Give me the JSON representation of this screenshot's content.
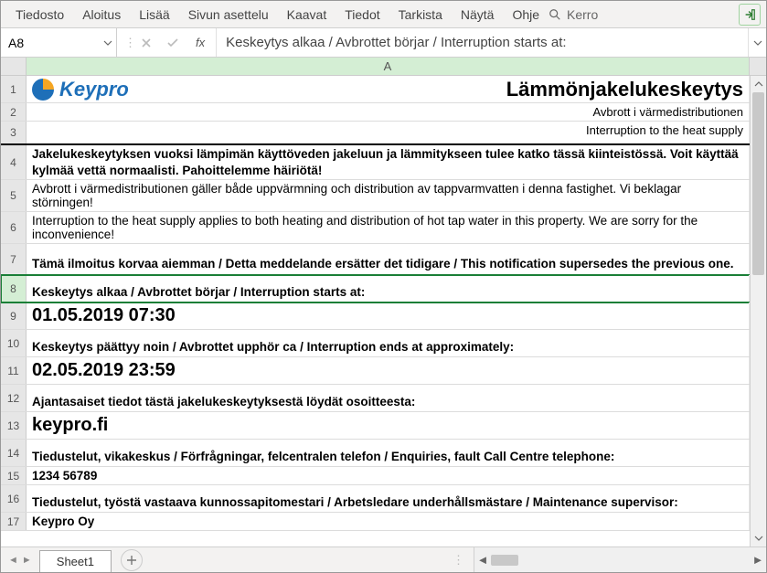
{
  "ribbon": {
    "tabs": [
      "Tiedosto",
      "Aloitus",
      "Lisää",
      "Sivun asettelu",
      "Kaavat",
      "Tiedot",
      "Tarkista",
      "Näytä",
      "Ohje"
    ],
    "tell": "Kerro"
  },
  "namebox": {
    "value": "A8"
  },
  "formula": {
    "fx": "fx",
    "value": "Keskeytys alkaa / Avbrottet börjar / Interruption starts at:"
  },
  "colHeaders": [
    "A"
  ],
  "sheet": {
    "brand": "Keypro",
    "title": "Lämmönjakelukeskeytys",
    "sub_sv": "Avbrott i värmedistributionen",
    "sub_en": "Interruption to the heat supply",
    "r4": "Jakelukeskeytyksen vuoksi lämpimän käyttöveden jakeluun ja lämmitykseen tulee katko tässä kiinteistössä. Voit käyttää kylmää vettä normaalisti. Pahoittelemme häiriötä!",
    "r5": "Avbrott i värmedistributionen gäller både uppvärmning och distribution av tappvarmvatten i denna fastighet. Vi beklagar störningen!",
    "r6": "Interruption to the heat supply applies to both heating and distribution of hot tap water in this property. We are sorry for the inconvenience!",
    "r7": "Tämä ilmoitus korvaa aiemman / Detta meddelande ersätter det tidigare / This notification supersedes the previous one.",
    "r8": "Keskeytys alkaa / Avbrottet börjar / Interruption starts at:",
    "r9": "01.05.2019 07:30",
    "r10": "Keskeytys päättyy noin / Avbrottet upphör ca / Interruption ends at approximately:",
    "r11": "02.05.2019 23:59",
    "r12": "Ajantasaiset tiedot tästä jakelukeskeytyksestä löydät osoitteesta:",
    "r13": "keypro.fi",
    "r14": "Tiedustelut, vikakeskus / Förfrågningar, felcentralen telefon / Enquiries, fault Call Centre telephone:",
    "r15": "1234 56789",
    "r16": "Tiedustelut, työstä vastaava kunnossapitomestari / Arbetsledare underhållsmästare / Maintenance supervisor:",
    "r17": "Keypro Oy"
  },
  "tabs": {
    "sheet1": "Sheet1"
  }
}
